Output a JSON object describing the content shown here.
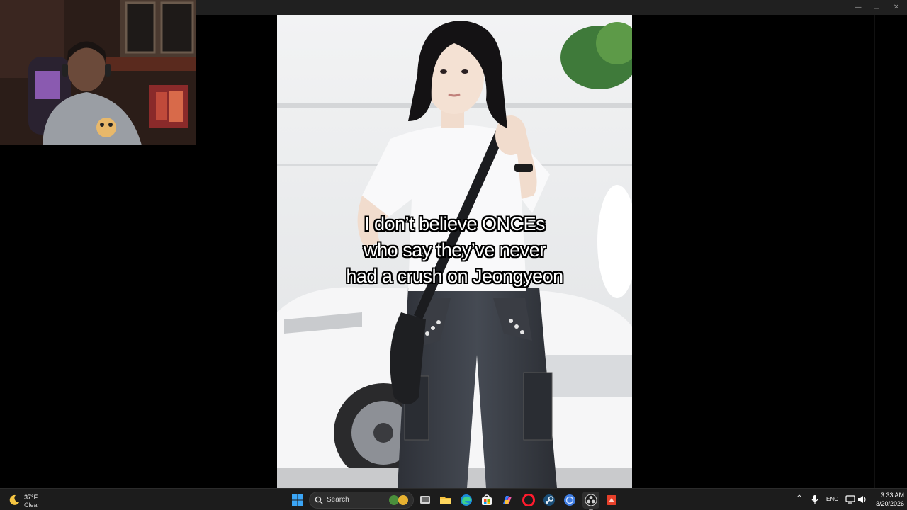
{
  "window": {
    "controls": {
      "minimize": "—",
      "restore": "❐",
      "close": "✕"
    }
  },
  "viewer": {
    "caption_lines": [
      "I don’t believe ONCEs",
      "who say they’ve never",
      "had a crush on Jeongyeon"
    ]
  },
  "taskbar": {
    "weather": {
      "temp": "37°F",
      "condition": "Clear",
      "icon": "moon-icon"
    },
    "search": {
      "label": "Search"
    },
    "apps": [
      {
        "name": "start-button",
        "icon": "windows-logo-icon"
      },
      {
        "name": "task-view",
        "icon": "task-view-icon"
      },
      {
        "name": "file-explorer",
        "icon": "folder-icon"
      },
      {
        "name": "edge",
        "icon": "edge-icon"
      },
      {
        "name": "microsoft-store",
        "icon": "store-icon"
      },
      {
        "name": "copilot",
        "icon": "copilot-icon"
      },
      {
        "name": "opera",
        "icon": "opera-icon"
      },
      {
        "name": "steam",
        "icon": "steam-icon"
      },
      {
        "name": "app-blue",
        "icon": "globe-icon"
      },
      {
        "name": "obs",
        "icon": "obs-icon"
      },
      {
        "name": "app-red",
        "icon": "red-app-icon"
      }
    ],
    "tray": {
      "chevron": "^",
      "language": "ENG",
      "time": "3:33 AM",
      "date": "3/20/2026"
    }
  },
  "colors": {
    "taskbar_bg": "#1c1c1c",
    "accent_blue": "#0a84ff",
    "caption_fill": "#ffffff",
    "caption_outline": "#000000"
  }
}
